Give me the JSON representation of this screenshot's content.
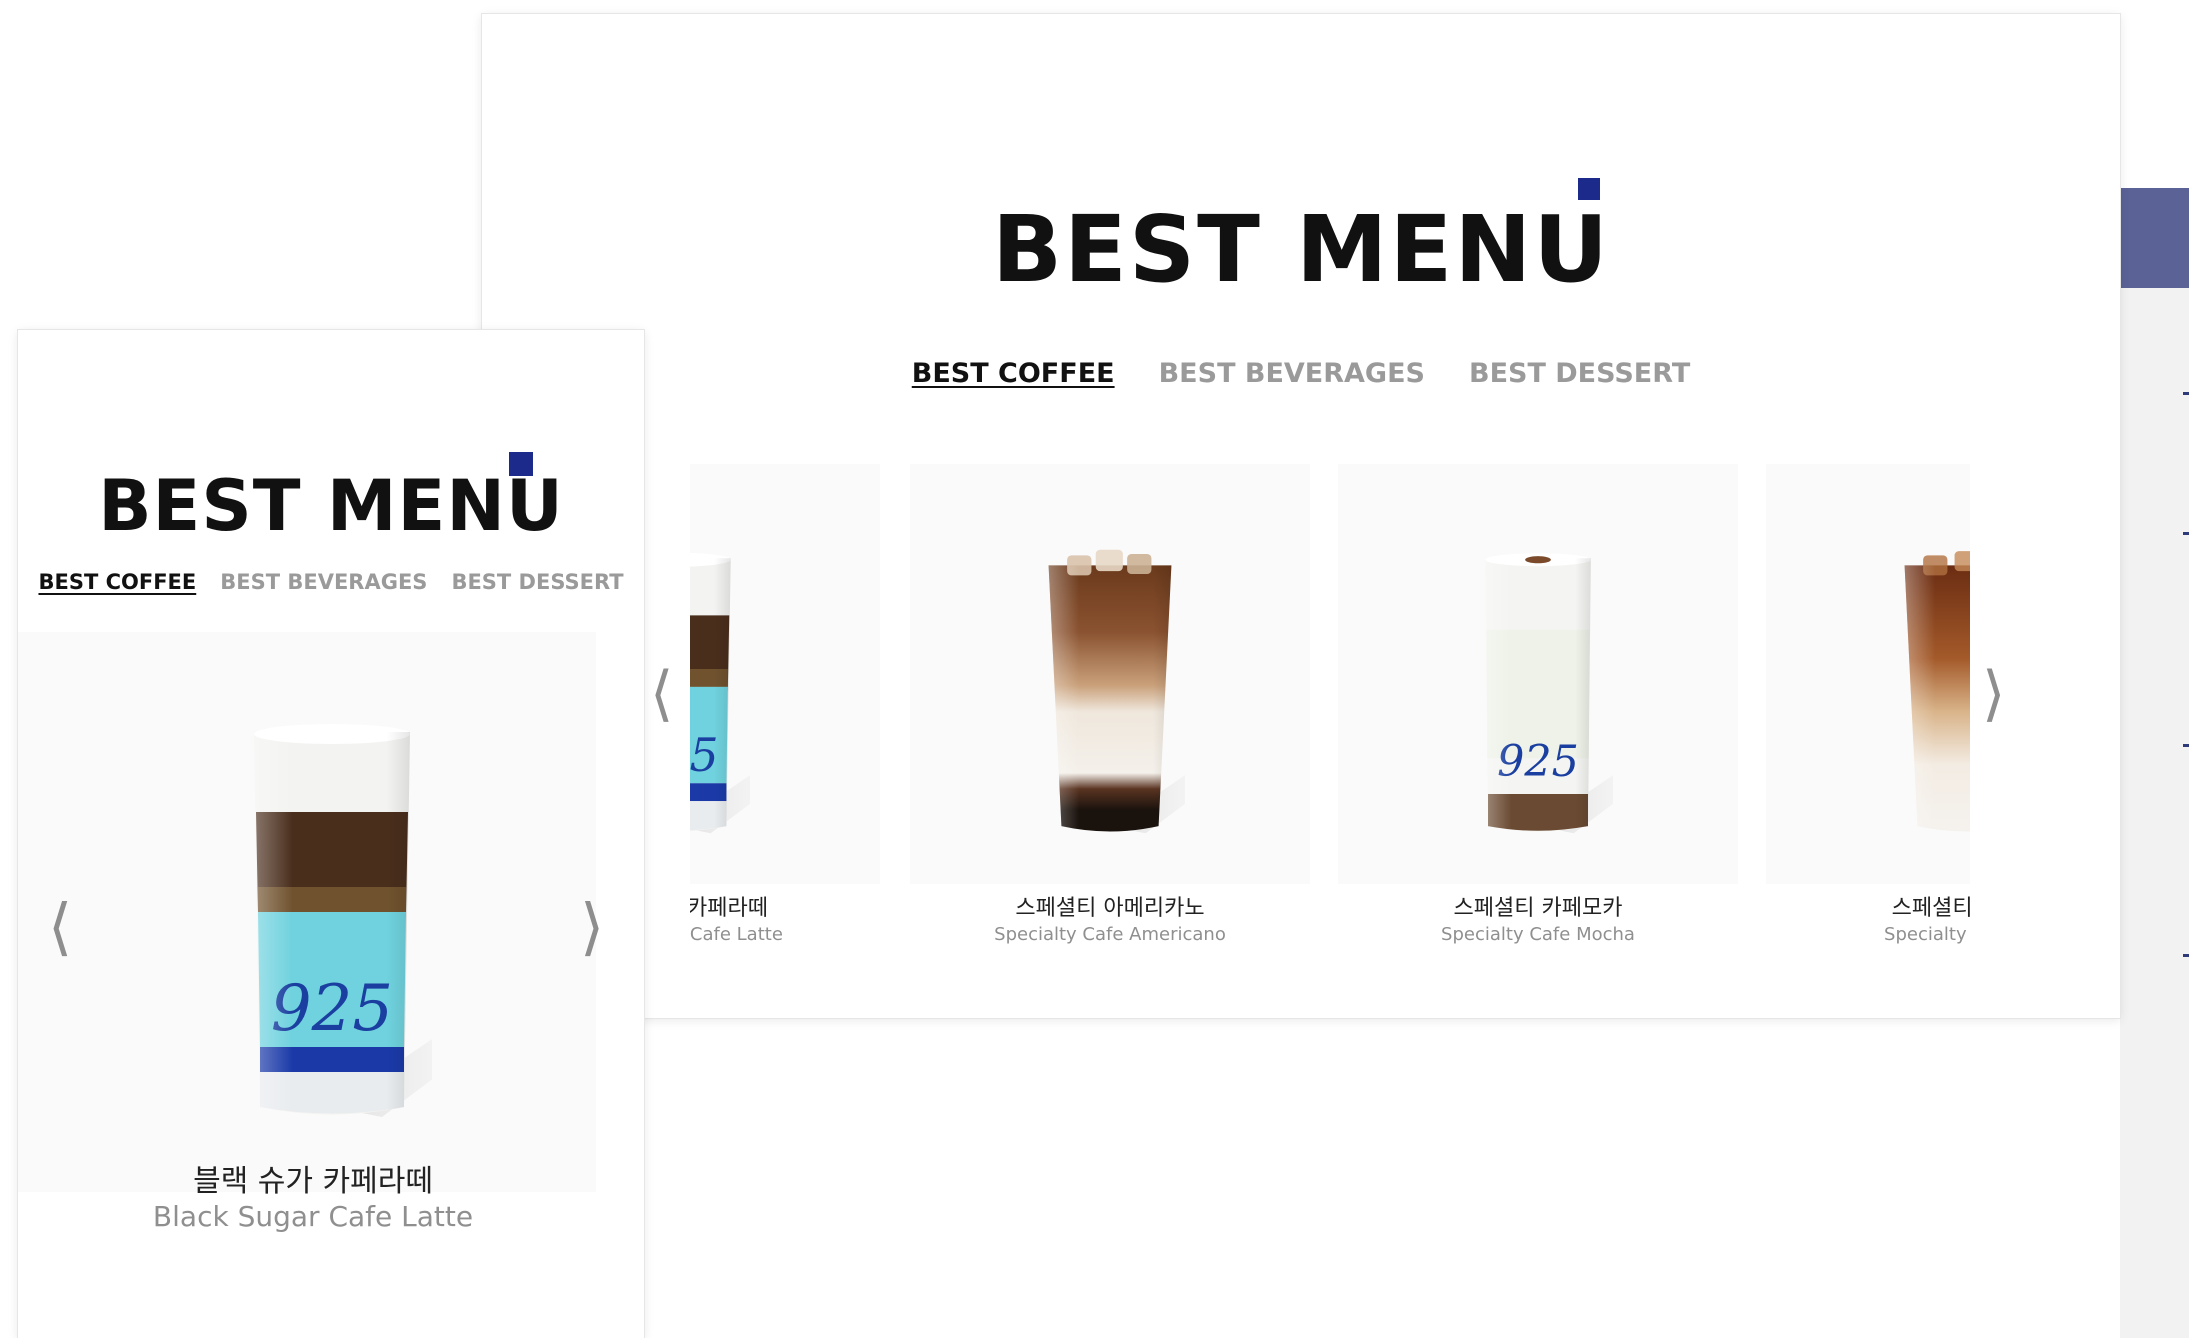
{
  "colors": {
    "accent": "#1c2a8c",
    "side_header": "#5a6296",
    "active_tab": "#111111",
    "inactive_tab": "#9a9a9a"
  },
  "desktop": {
    "title": "BEST MENU",
    "tabs": [
      {
        "label": "BEST COFFEE",
        "active": true
      },
      {
        "label": "BEST BEVERAGES",
        "active": false
      },
      {
        "label": "BEST DESSERT",
        "active": false
      }
    ],
    "prev_icon": "chevron-left-icon",
    "next_icon": "chevron-right-icon",
    "items": [
      {
        "name_ko": "블랙 슈가 카페라떼",
        "name_en": "Black Sugar Cafe Latte",
        "drink": "layered-blue"
      },
      {
        "name_ko": "스페셜티 아메리카노",
        "name_en": "Specialty Cafe Americano",
        "drink": "iced-latte"
      },
      {
        "name_ko": "스페셜티 카페모카",
        "name_en": "Specialty Cafe Mocha",
        "drink": "white-cup"
      },
      {
        "name_ko": "스페셜티 카라멜",
        "name_en": "Specialty Caramel",
        "drink": "caramel"
      }
    ]
  },
  "mobile": {
    "title": "BEST MENU",
    "tabs": [
      {
        "label": "BEST COFFEE",
        "active": true
      },
      {
        "label": "BEST BEVERAGES",
        "active": false
      },
      {
        "label": "BEST DESSERT",
        "active": false
      }
    ],
    "prev_icon": "chevron-left-icon",
    "next_icon": "chevron-right-icon",
    "item": {
      "name_ko": "블랙 슈가 카페라떼",
      "name_en": "Black Sugar Cafe Latte",
      "drink": "layered-blue"
    }
  }
}
